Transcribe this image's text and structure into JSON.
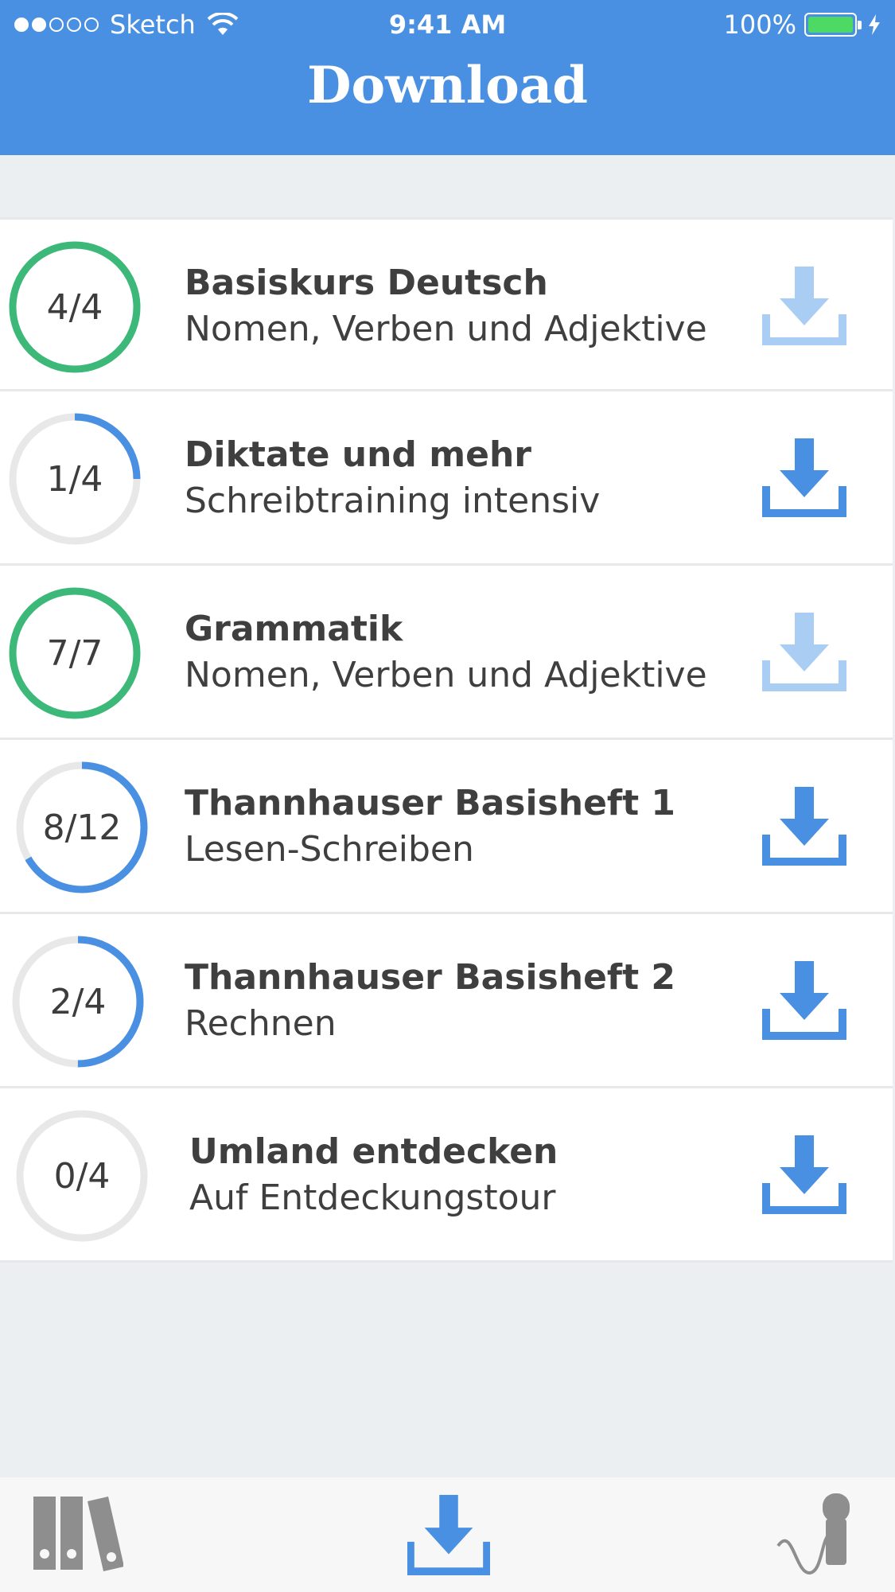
{
  "status_bar": {
    "carrier": "Sketch",
    "time": "9:41 AM",
    "battery": "100%"
  },
  "header": {
    "title": "Download"
  },
  "courses": [
    {
      "progress": "4/4",
      "done": 4,
      "total": 4,
      "title": "Basiskurs Deutsch",
      "subtitle": "Nomen, Verben und Adjektive",
      "download_enabled": false
    },
    {
      "progress": "1/4",
      "done": 1,
      "total": 4,
      "title": "Diktate und mehr",
      "subtitle": "Schreibtraining intensiv",
      "download_enabled": true
    },
    {
      "progress": "7/7",
      "done": 7,
      "total": 7,
      "title": "Grammatik",
      "subtitle": "Nomen, Verben und Adjektive",
      "download_enabled": false
    },
    {
      "progress": "8/12",
      "done": 8,
      "total": 12,
      "title": "Thannhauser Basisheft 1",
      "subtitle": "Lesen-Schreiben",
      "download_enabled": true
    },
    {
      "progress": "2/4",
      "done": 2,
      "total": 4,
      "title": "Thannhauser Basisheft 2",
      "subtitle": "Rechnen",
      "download_enabled": true
    },
    {
      "progress": "0/4",
      "done": 0,
      "total": 4,
      "title": "Umland entdecken",
      "subtitle": "Auf Entdeckungstour",
      "download_enabled": true
    }
  ],
  "colors": {
    "header_blue": "#4a90e2",
    "complete_green": "#3cb878",
    "progress_blue": "#4a90e2",
    "track_gray": "#e8e8e8",
    "download_blue": "#4a90e2",
    "download_disabled": "#a9cdf3",
    "tab_inactive": "#8e8e8e"
  },
  "tabs": [
    {
      "icon": "library-icon",
      "active": false
    },
    {
      "icon": "download-icon",
      "active": true
    },
    {
      "icon": "microphone-icon",
      "active": false
    }
  ]
}
